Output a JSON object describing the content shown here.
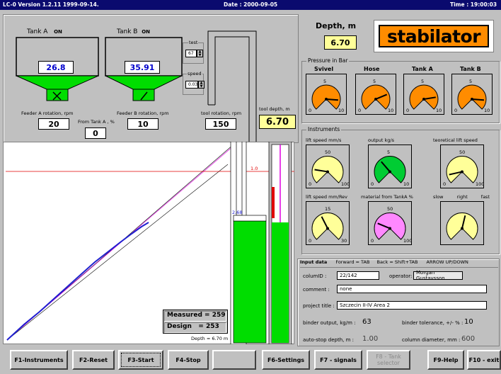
{
  "titlebar": {
    "version": "LC-0 Version 1.2.11 1999-09-14.",
    "date": "Date : 2000-09-05",
    "time": "Time : 19:00:03"
  },
  "tanks": {
    "a": {
      "title": "Tank A",
      "status": "ON",
      "value": "26.8"
    },
    "b": {
      "title": "Tank B",
      "status": "ON",
      "value": "35.91"
    }
  },
  "spinners": {
    "test_label": "test",
    "test_value": "67",
    "speed_label": "speed",
    "speed_value": "0.03"
  },
  "rotations": {
    "feeder_a_label": "Feeder A rotation, rpm",
    "feeder_a_value": "20",
    "feeder_b_label": "Feeder B rotation, rpm",
    "feeder_b_value": "10",
    "tool_label": "tool rotation, rpm",
    "tool_value": "150",
    "from_tank_a_label": "From Tank A , %",
    "from_tank_a_value": "0"
  },
  "tool_depth": {
    "label": "tool depth, m",
    "value": "6.70"
  },
  "depth": {
    "label": "Depth, m",
    "value": "6.70"
  },
  "logo": "stabilator",
  "pressure": {
    "title": "Pressure in Bar",
    "gauges": [
      {
        "name": "Svivel",
        "min": "0",
        "mid": "5",
        "max": "10",
        "value": 8.5,
        "fill": "#ff8c00"
      },
      {
        "name": "Hose",
        "min": "0",
        "mid": "5",
        "max": "10",
        "value": 7.5,
        "fill": "#ff8c00"
      },
      {
        "name": "Tank A",
        "min": "0",
        "mid": "5",
        "max": "10",
        "value": 8,
        "fill": "#ff8c00"
      },
      {
        "name": "Tank B",
        "min": "0",
        "mid": "5",
        "max": "10",
        "value": 8.5,
        "fill": "#ff8c00"
      }
    ]
  },
  "instruments": {
    "title": "Instruments",
    "gauges": [
      {
        "name": "lift speed mm/s",
        "min": "0",
        "mid": "50",
        "max": "100",
        "value": 20,
        "fill": "#ffff99"
      },
      {
        "name": "output kg/s",
        "min": "0",
        "mid": "5",
        "max": "10",
        "value": 3.5,
        "fill": "#00cc33"
      },
      {
        "name": "teoretical lift speed",
        "min": "0",
        "mid": "50",
        "max": "100",
        "value": 12,
        "fill": "#ffff99"
      },
      {
        "name": "lift speed mm/Rev",
        "min": "0",
        "mid": "15",
        "max": "30",
        "value": 12,
        "fill": "#ffff99"
      },
      {
        "name": "material from TankA %",
        "min": "0",
        "mid": "50",
        "max": "100",
        "value": 25,
        "fill": "#ff88ff"
      },
      {
        "name": "slow",
        "name2": "right",
        "name3": "fast",
        "min": "",
        "mid": "",
        "max": "",
        "value": 55,
        "fill": "#ffff99"
      }
    ]
  },
  "graph": {
    "red_line_label": "1.0",
    "blue_label": "2.68",
    "measured_label": "Measured",
    "measured_value": "= 259",
    "design_label": "Design",
    "design_value": "= 253",
    "depth_label": "Depth = 6.70 m"
  },
  "input": {
    "title": "Input data",
    "hint_forward": "Forward = TAB",
    "hint_back": "Back = Shift+TAB",
    "hint_arrow": "ARROW UP/DOWN",
    "column_id_label": "columID :",
    "column_id_value": "22/142",
    "operator_label": "operator:",
    "operator_value": "Morgan Gustavsson",
    "comment_label": "comment :",
    "comment_value": "none",
    "project_label": "project title :",
    "project_value": "Szczecin II-IV Area 2",
    "binder_output_label": "binder output, kg/m :",
    "binder_output_value": "63",
    "binder_tol_label": "binder tolerance, +/- % :",
    "binder_tol_value": "10",
    "autostop_label": "auto-stop depth, m :",
    "autostop_value": "1.00",
    "column_diam_label": "column diameter, mm :",
    "column_diam_value": "600"
  },
  "buttons": {
    "f1": "F1-Instruments",
    "f2": "F2-Reset",
    "f3": "F3-Start",
    "f4": "F4-Stop",
    "f6": "F6-Settings",
    "f7": "F7 - signals",
    "f8": "F8 - Tank selector",
    "f9": "F9-Help",
    "f10": "F10 - exit"
  }
}
